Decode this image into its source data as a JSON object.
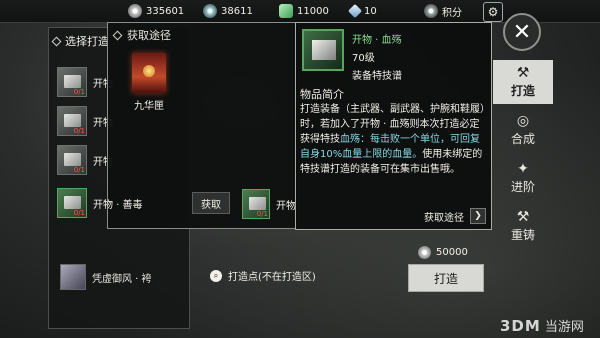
{
  "currencies": [
    {
      "icon": "coin-icon",
      "value": "335601"
    },
    {
      "icon": "silver-icon",
      "value": "38611"
    },
    {
      "icon": "jade-icon",
      "value": "11000"
    },
    {
      "icon": "gem-icon",
      "value": "10"
    },
    {
      "icon": "points-icon",
      "value": "积分"
    }
  ],
  "left_panel": {
    "title": "选择打造",
    "items": [
      {
        "name": "开物",
        "count": "0/1"
      },
      {
        "name": "开物",
        "count": "0/1"
      },
      {
        "name": "开物",
        "count": "0/1"
      }
    ]
  },
  "acquire_popup": {
    "title": "获取途径",
    "item_label": "九华匣"
  },
  "list_row": {
    "name": "开物 · 善毒",
    "count": "0/1",
    "button": "获取",
    "next_name": "开物",
    "next_count": "0/1"
  },
  "lower_list": [
    {
      "name": "凭虚御风 · 袴"
    }
  ],
  "detail": {
    "name": "开物 · 血殇",
    "level": "70级",
    "type": "装备特技谱",
    "section": "物品简介",
    "desc_part1": "打造装备（主武器、副武器、护腕和鞋履）时，若加入了开物 · 血殇则本次打造必定获得特技",
    "desc_highlight": "血殇：每击败一个单位，可回复自身10%血量上限的血量。",
    "desc_part2": "使用未绑定的特技谱打造的装备可在集市出售哦。",
    "route_button": "获取途径"
  },
  "right_nav": [
    {
      "label": "打造",
      "icon": "anvil-icon",
      "glyph": "⚒",
      "active": true
    },
    {
      "label": "合成",
      "icon": "synthesis-icon",
      "glyph": "◎",
      "active": false
    },
    {
      "label": "进阶",
      "icon": "advance-icon",
      "glyph": "✦",
      "active": false
    },
    {
      "label": "重铸",
      "icon": "hammer-icon",
      "glyph": "⚒",
      "active": false
    }
  ],
  "craft": {
    "cost": "50000",
    "button": "打造",
    "location": "打造点(不在打造区)"
  },
  "watermark": {
    "logo": "3DM",
    "text": "当游网"
  }
}
